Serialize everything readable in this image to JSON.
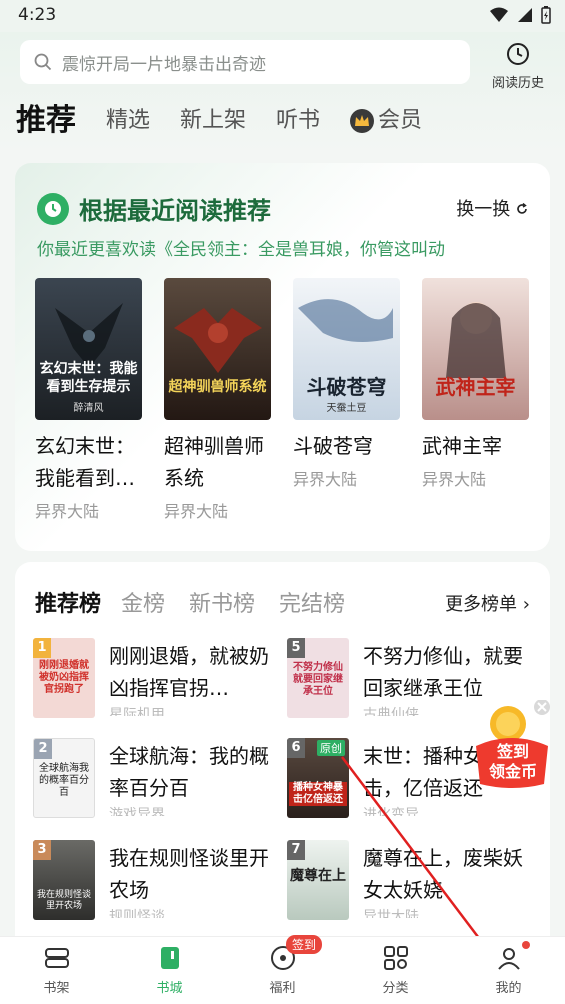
{
  "status": {
    "time": "4:23"
  },
  "search": {
    "placeholder": "震惊开局一片地暴击出奇迹"
  },
  "history": {
    "label": "阅读历史"
  },
  "tabs": [
    {
      "label": "推荐"
    },
    {
      "label": "精选"
    },
    {
      "label": "新上架"
    },
    {
      "label": "听书"
    },
    {
      "label": "会员"
    }
  ],
  "recommend": {
    "title": "根据最近阅读推荐",
    "refresh": "换一换",
    "subtitle": "你最近更喜欢读《全民领主：全是兽耳娘，你管这叫动",
    "books": [
      {
        "name": "玄幻末世：我能看到…",
        "category": "异界大陆",
        "cover_text": "玄幻末世：我能看到生存提示",
        "cover_author": "醉清风",
        "cover_color": "#2b3138"
      },
      {
        "name": "超神驯兽师系统",
        "category": "异界大陆",
        "cover_text": "超神驯兽师系统",
        "cover_color": "#3a2620"
      },
      {
        "name": "斗破苍穹",
        "category": "异界大陆",
        "cover_text": "斗破苍穹",
        "cover_author": "天蚕土豆",
        "cover_color": "#dfe6ee"
      },
      {
        "name": "武神主宰",
        "category": "异界大陆",
        "cover_text": "武神主宰",
        "cover_color": "#c9a9a6"
      }
    ]
  },
  "ranking": {
    "tabs": [
      {
        "label": "推荐榜"
      },
      {
        "label": "金榜"
      },
      {
        "label": "新书榜"
      },
      {
        "label": "完结榜"
      }
    ],
    "more": "更多榜单",
    "items": [
      {
        "rank": "1",
        "title": "刚刚退婚，就被奶凶指挥官拐…",
        "sub": "星际机甲",
        "cover_text": "刚刚退婚就被奶凶指挥官拐跑了",
        "cover_color": "#f3d9d5",
        "rank_color": "#f2b33d"
      },
      {
        "rank": "5",
        "title": "不努力修仙，就要回家继承王位",
        "sub": "古典仙侠",
        "cover_text": "不努力修仙就要回家继承王位",
        "cover_color": "#f0dfe3",
        "rank_color": "#666666"
      },
      {
        "rank": "2",
        "title": "全球航海：我的概率百分百",
        "sub": "游戏异界",
        "cover_text": "全球航海我的概率百分百",
        "cover_color": "#f4f4f4",
        "rank_color": "#9aa4b2"
      },
      {
        "rank": "6",
        "title": "末世：播种女…暴击，亿倍返还",
        "sub": "进化变异",
        "cover_text": "播种女神暴击亿倍返还",
        "cover_color": "#3a2e2a",
        "rank_color": "#666666",
        "tag": "原创"
      },
      {
        "rank": "3",
        "title": "我在规则怪谈里开农场",
        "sub": "规则怪谈",
        "cover_text": "我在规则怪谈里开农场",
        "cover_color": "#4a4a48",
        "rank_color": "#c98a5a"
      },
      {
        "rank": "7",
        "title": "魔尊在上，废柴妖女太妖娆",
        "sub": "异世大陆",
        "cover_text": "魔尊在上",
        "cover_color": "#dfe8e2",
        "rank_color": "#666666"
      }
    ]
  },
  "float_badge": {
    "line1": "签到",
    "line2": "领金币"
  },
  "bottom_nav": [
    {
      "label": "书架"
    },
    {
      "label": "书城"
    },
    {
      "label": "福利",
      "badge": "签到"
    },
    {
      "label": "分类"
    },
    {
      "label": "我的"
    }
  ]
}
